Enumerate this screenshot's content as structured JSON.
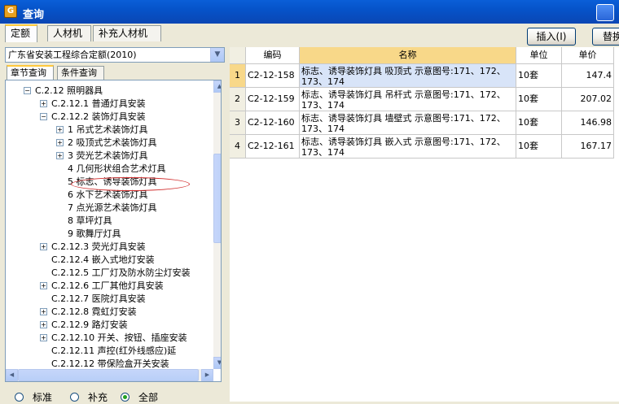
{
  "window": {
    "title": "查询"
  },
  "top_tabs": [
    "定额",
    "人材机",
    "补充人材机"
  ],
  "toolbar": {
    "insert_label": "插入(I)",
    "replace_label": "替换"
  },
  "combo": {
    "value": "广东省安装工程综合定额(2010)"
  },
  "sub_tabs": [
    "章节查询",
    "条件查询"
  ],
  "tree": [
    {
      "label": "C.2.12 照明器具"
    },
    {
      "label": "C.2.12.1 普通灯具安装"
    },
    {
      "label": "C.2.12.2 装饰灯具安装"
    },
    {
      "label": "1 吊式艺术装饰灯具"
    },
    {
      "label": "2 吸顶式艺术装饰灯具"
    },
    {
      "label": "3 荧光艺术装饰灯具"
    },
    {
      "label": "4 几何形状组合艺术灯具"
    },
    {
      "label": "5 标志、诱导装饰灯具"
    },
    {
      "label": "6 水下艺术装饰灯具"
    },
    {
      "label": "7 点光源艺术装饰灯具"
    },
    {
      "label": "8 草坪灯具"
    },
    {
      "label": "9 歌舞厅灯具"
    },
    {
      "label": "C.2.12.3 荧光灯具安装"
    },
    {
      "label": "C.2.12.4 嵌入式地灯安装"
    },
    {
      "label": "C.2.12.5 工厂灯及防水防尘灯安装"
    },
    {
      "label": "C.2.12.6 工厂其他灯具安装"
    },
    {
      "label": "C.2.12.7 医院灯具安装"
    },
    {
      "label": "C.2.12.8 霓虹灯安装"
    },
    {
      "label": "C.2.12.9 路灯安装"
    },
    {
      "label": "C.2.12.10 开关、按钮、插座安装"
    },
    {
      "label": "C.2.12.11 声控(红外线感应)延"
    },
    {
      "label": "C.2.12.12 带保险盒开关安装"
    }
  ],
  "radio": {
    "options": [
      "标准",
      "补充",
      "全部"
    ],
    "selected": "全部"
  },
  "grid": {
    "headers": [
      "编码",
      "名称",
      "单位",
      "单价"
    ],
    "rows": [
      {
        "num": "1",
        "code": "C2-12-158",
        "name": "标志、诱导装饰灯具 吸顶式 示意图号:171、172、173、174",
        "unit": "10套",
        "price": "147.4"
      },
      {
        "num": "2",
        "code": "C2-12-159",
        "name": "标志、诱导装饰灯具 吊杆式 示意图号:171、172、173、174",
        "unit": "10套",
        "price": "207.02"
      },
      {
        "num": "3",
        "code": "C2-12-160",
        "name": "标志、诱导装饰灯具 墙壁式 示意图号:171、172、173、174",
        "unit": "10套",
        "price": "146.98"
      },
      {
        "num": "4",
        "code": "C2-12-161",
        "name": "标志、诱导装饰灯具 嵌入式 示意图号:171、172、173、174",
        "unit": "10套",
        "price": "167.17"
      }
    ]
  }
}
